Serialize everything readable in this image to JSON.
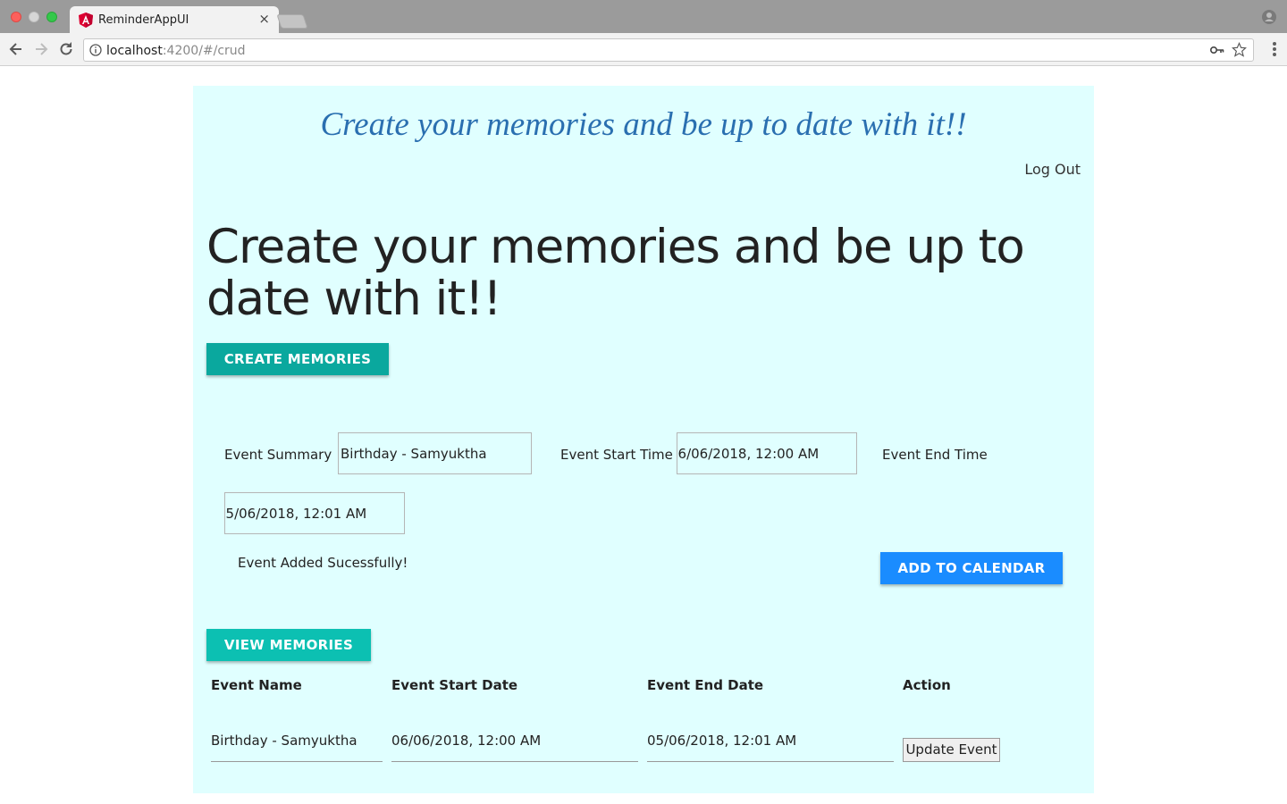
{
  "browser": {
    "tab_title": "ReminderAppUI",
    "tab_close": "×",
    "url_host": "localhost",
    "url_rest": ":4200/#/crud"
  },
  "header": {
    "banner": "Create your memories and be up to date with it!!",
    "logout": "Log Out"
  },
  "main": {
    "heading": "Create your memories and be up to date with it!!",
    "create_button": "CREATE MEMORIES"
  },
  "form": {
    "summary_label": "Event Summary",
    "summary_value": "Birthday - Samyuktha",
    "start_label": "Event Start Time",
    "start_value": "06/06/2018, 12:00 AM",
    "end_label": "Event End Time",
    "end_value": "05/06/2018, 12:01 AM",
    "status_message": "Event Added Sucessfully!",
    "add_button": "ADD TO CALENDAR"
  },
  "table": {
    "view_button": "VIEW MEMORIES",
    "headers": [
      "Event Name",
      "Event Start Date",
      "Event End Date",
      "Action"
    ],
    "rows": [
      {
        "name": "Birthday - Samyuktha",
        "start": "06/06/2018, 12:00 AM",
        "end": "05/06/2018, 12:01 AM",
        "action": "Update Event"
      }
    ]
  }
}
